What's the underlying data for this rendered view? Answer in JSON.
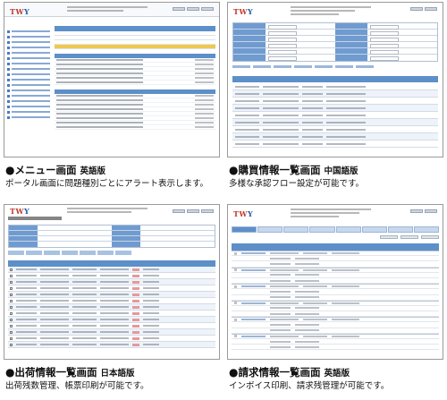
{
  "panels": [
    {
      "id": "menu",
      "title": "メニュー画面",
      "lang": "英語版",
      "desc": "ポータル画面に問題種別ごとにアラート表示します。"
    },
    {
      "id": "purchase",
      "title": "購買情報一覧画面",
      "lang": "中国語版",
      "desc": "多様な承認フロー設定が可能です。"
    },
    {
      "id": "shipping",
      "title": "出荷情報一覧画面",
      "lang": "日本語版",
      "desc": "出荷残数管理、帳票印刷が可能です。"
    },
    {
      "id": "invoice",
      "title": "請求情報一覧画面",
      "lang": "英語版",
      "desc": "インボイス印刷、請求残管理が可能です。"
    }
  ],
  "bullet": "●",
  "logo": {
    "main": "TW",
    "accent": "Y"
  },
  "colors": {
    "header_blue": "#5d8fc9",
    "label_blue": "#6f9bd0",
    "alert_yellow": "#f2c84b",
    "logo_red": "#c0392b"
  }
}
